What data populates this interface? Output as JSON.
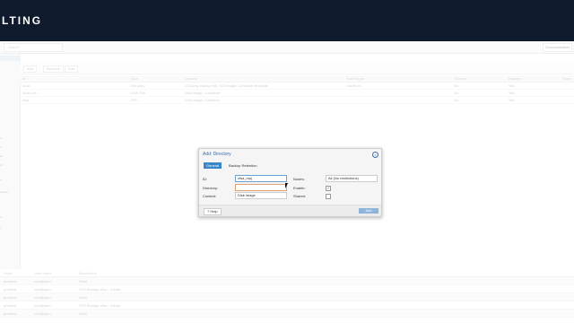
{
  "brand": "LTING",
  "toolbar": {
    "search_placeholder": "Search",
    "documentation": "Documentation"
  },
  "nav_labels": [
    "s",
    "s",
    "es",
    "rk",
    "e",
    "ication",
    "s",
    "t"
  ],
  "content_toolbar": {
    "add": "Add",
    "remove": "Remove",
    "edit": "Edit"
  },
  "storage_table": {
    "headers": [
      "ID ↑",
      "Type",
      "Content",
      "Path/Target",
      "Shared",
      "Enabled",
      "Band"
    ],
    "rows": [
      [
        "local",
        "Directory",
        "VZDump backup file, ISO image, Container template",
        "/var/lib/vz",
        "No",
        "Yes",
        ""
      ],
      [
        "local-lvm",
        "LVM-Thin",
        "Disk image, Container",
        "",
        "No",
        "Yes",
        ""
      ],
      [
        "zfsa",
        "ZFS",
        "Disk image, Container",
        "",
        "No",
        "Yes",
        ""
      ]
    ]
  },
  "tasks_table": {
    "headers": [
      "Node",
      "User name",
      "Description"
    ],
    "rows": [
      [
        "proxtest",
        "root@pam",
        "Shell"
      ],
      [
        "proxtest",
        "root@pam",
        "ZFS Storage zfsa - Create"
      ],
      [
        "proxtest",
        "root@pam",
        "Shell"
      ],
      [
        "proxtest",
        "root@pam",
        "ZFS Storage zfsa - Create"
      ],
      [
        "proxtest",
        "root@pam",
        "Shell"
      ]
    ]
  },
  "dialog": {
    "title": "Add: Directory",
    "close": "×",
    "tabs": {
      "general": "General",
      "backup": "Backup Retention"
    },
    "fields": {
      "id_label": "ID:",
      "id_value": "zfsa_mp|",
      "directory_label": "Directory:",
      "directory_value": "",
      "content_label": "Content:",
      "content_value": "Disk image",
      "nodes_label": "Nodes:",
      "nodes_value": "All (No restrictions)",
      "enable_label": "Enable:",
      "enable_checked": "✓",
      "shared_label": "Shared:",
      "shared_checked": ""
    },
    "help": "Help",
    "add": "Add"
  }
}
